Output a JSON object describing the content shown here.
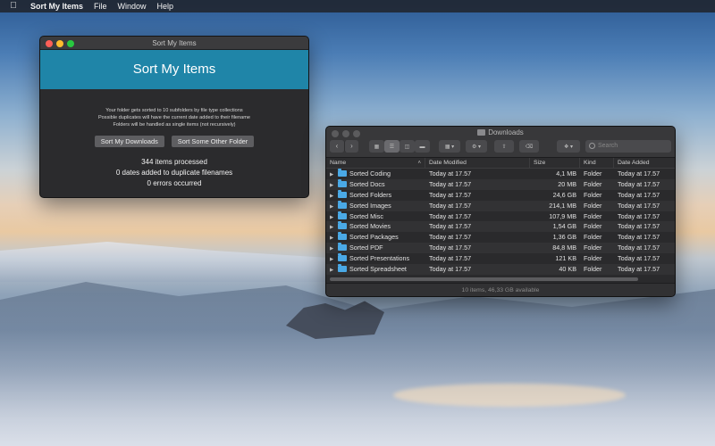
{
  "menubar": {
    "app": "Sort My Items",
    "items": [
      "File",
      "Window",
      "Help"
    ]
  },
  "sort_window": {
    "title": "Sort My Items",
    "heading": "Sort My Items",
    "desc_lines": [
      "Your folder gets sorted to 10 subfolders by file type collections",
      "Possible duplicates will have the current date added to their filename",
      "Folders will be handled as single items (not recursively)"
    ],
    "buttons": {
      "downloads": "Sort My Downloads",
      "other": "Sort Some Other Folder"
    },
    "stats": [
      "344 items processed",
      "0 dates added to duplicate filenames",
      "0 errors occurred"
    ],
    "colors": {
      "banner": "#1f85a8"
    }
  },
  "downloads_window": {
    "title": "Downloads",
    "search_placeholder": "Search",
    "columns": {
      "name": "Name",
      "date_modified": "Date Modified",
      "size": "Size",
      "kind": "Kind",
      "date_added": "Date Added"
    },
    "rows": [
      {
        "name": "Sorted Coding",
        "date_modified": "Today at 17.57",
        "size": "4,1 MB",
        "kind": "Folder",
        "date_added": "Today at 17.57"
      },
      {
        "name": "Sorted Docs",
        "date_modified": "Today at 17.57",
        "size": "20 MB",
        "kind": "Folder",
        "date_added": "Today at 17.57"
      },
      {
        "name": "Sorted Folders",
        "date_modified": "Today at 17.57",
        "size": "24,6 GB",
        "kind": "Folder",
        "date_added": "Today at 17.57"
      },
      {
        "name": "Sorted Images",
        "date_modified": "Today at 17.57",
        "size": "214,1 MB",
        "kind": "Folder",
        "date_added": "Today at 17.57"
      },
      {
        "name": "Sorted Misc",
        "date_modified": "Today at 17.57",
        "size": "107,9 MB",
        "kind": "Folder",
        "date_added": "Today at 17.57"
      },
      {
        "name": "Sorted Movies",
        "date_modified": "Today at 17.57",
        "size": "1,54 GB",
        "kind": "Folder",
        "date_added": "Today at 17.57"
      },
      {
        "name": "Sorted Packages",
        "date_modified": "Today at 17.57",
        "size": "1,36 GB",
        "kind": "Folder",
        "date_added": "Today at 17.57"
      },
      {
        "name": "Sorted PDF",
        "date_modified": "Today at 17.57",
        "size": "84,8 MB",
        "kind": "Folder",
        "date_added": "Today at 17.57"
      },
      {
        "name": "Sorted Presentations",
        "date_modified": "Today at 17.57",
        "size": "121 KB",
        "kind": "Folder",
        "date_added": "Today at 17.57"
      },
      {
        "name": "Sorted Spreadsheet",
        "date_modified": "Today at 17.57",
        "size": "40 KB",
        "kind": "Folder",
        "date_added": "Today at 17.57"
      }
    ],
    "status": "10 items, 46,33 GB available",
    "colors": {
      "folder_icon": "#4aa9e6"
    }
  }
}
